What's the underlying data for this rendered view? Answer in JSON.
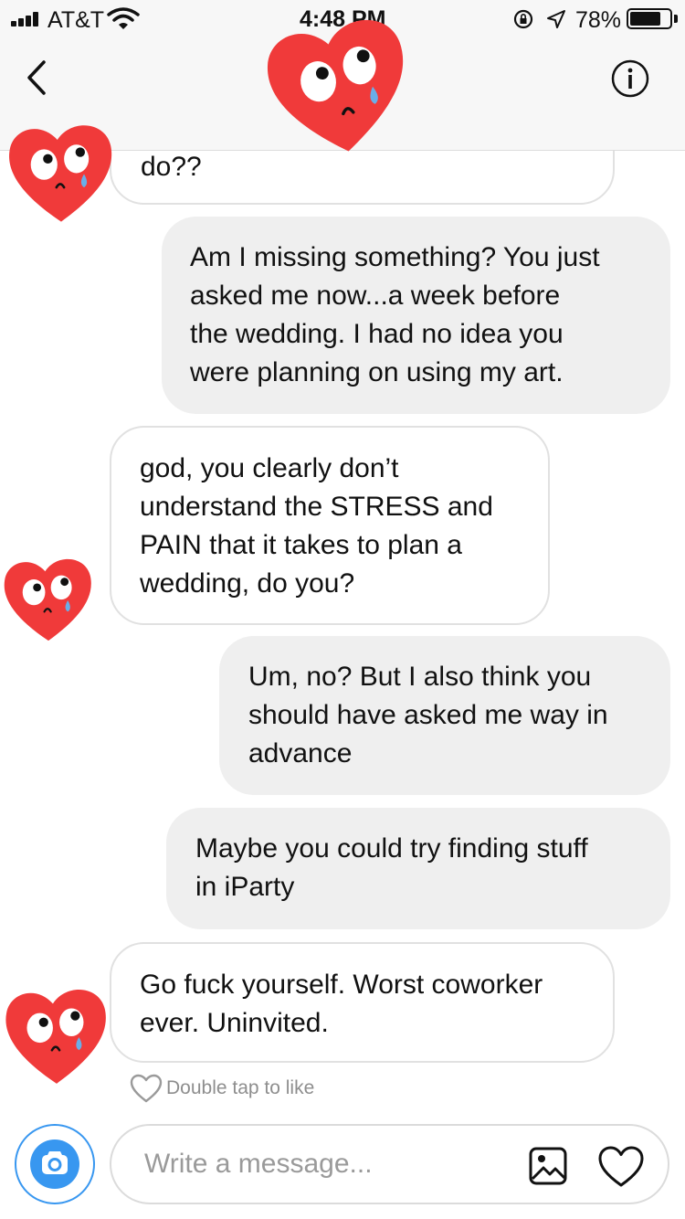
{
  "status_bar": {
    "carrier": "AT&T",
    "time": "4:48 PM",
    "battery_percent": "78%",
    "battery_level": 0.78,
    "icons": [
      "signal-icon",
      "wifi-icon",
      "rotation-lock-icon",
      "location-arrow-icon",
      "battery-icon"
    ]
  },
  "header": {
    "back_icon": "chevron-left-icon",
    "info_icon": "info-icon",
    "sticker": "crying-heart-sticker"
  },
  "messages": [
    {
      "side": "incoming",
      "lines": [
        "do??"
      ]
    },
    {
      "side": "outgoing",
      "lines": [
        "Am I missing something? You just",
        "asked me now...a week before",
        "the wedding. I had no idea you",
        "were planning on using my art."
      ]
    },
    {
      "side": "incoming",
      "lines": [
        "god, you clearly don’t",
        "understand the STRESS and",
        "PAIN that it takes to plan a",
        "wedding, do you?"
      ]
    },
    {
      "side": "outgoing",
      "lines": [
        "Um, no? But I also think you",
        "should have asked me way in",
        "advance"
      ]
    },
    {
      "side": "outgoing",
      "lines": [
        "Maybe you could try finding stuff",
        "in iParty"
      ]
    },
    {
      "side": "incoming",
      "lines": [
        "Go fuck yourself. Worst coworker",
        "ever. Uninvited."
      ]
    }
  ],
  "like_hint": {
    "label": "Double tap to like",
    "icon": "heart-outline-icon"
  },
  "composer": {
    "placeholder": "Write a message...",
    "value": "",
    "camera_icon": "camera-icon",
    "gallery_icon": "image-icon",
    "like_icon": "heart-outline-icon"
  },
  "colors": {
    "accent": "#3897f0",
    "heart": "#f03a3a",
    "tear": "#6aaee8",
    "outgoing_bubble": "#efefef",
    "incoming_border": "#e1e1e1"
  }
}
